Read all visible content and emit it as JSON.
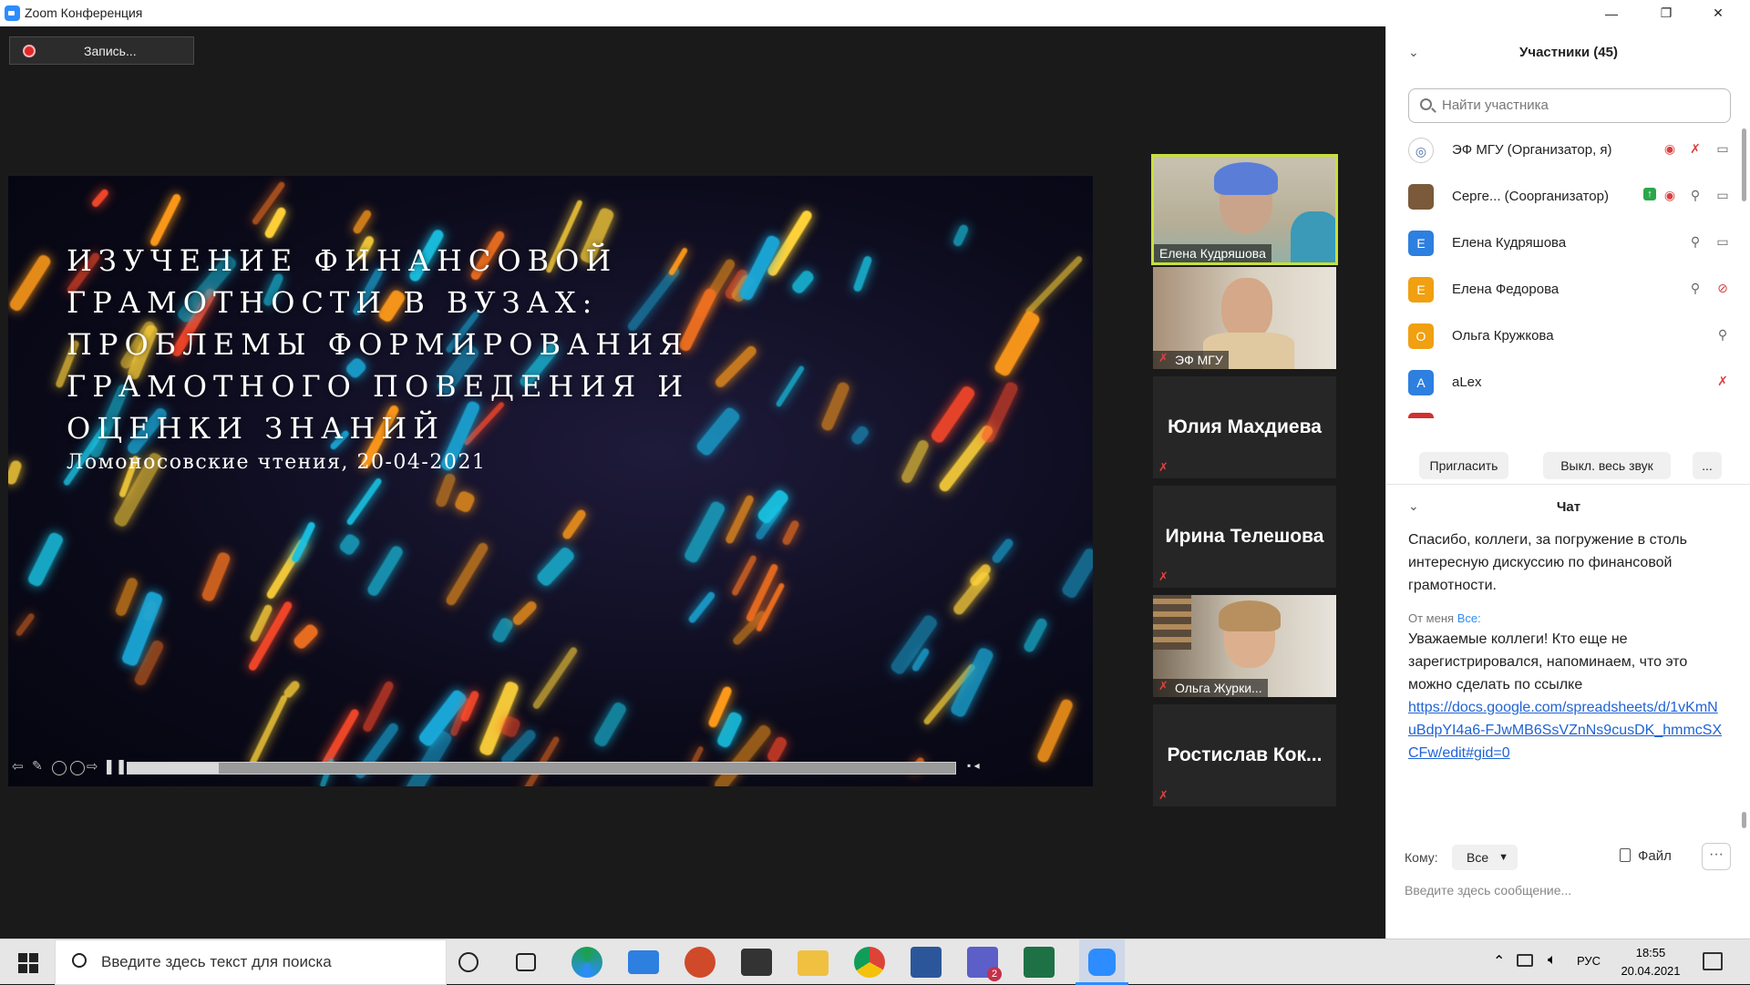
{
  "window": {
    "title": "Zoom Конференция",
    "buttons": {
      "minimize": "—",
      "maximize": "❐",
      "close": "✕"
    }
  },
  "recording": {
    "label": "Запись..."
  },
  "slide": {
    "title": "Изучение финансовой грамотности в вузах: проблемы формирования грамотного поведения и оценки знаний",
    "subtitle": "Ломоносовские чтения, 20-04-2021",
    "progress": 0.11
  },
  "videos": [
    {
      "name": "Елена Кудряшова",
      "type": "video",
      "active": true
    },
    {
      "name": "ЭФ МГУ",
      "type": "video",
      "muted": true
    },
    {
      "name": "Юлия Махдиева",
      "type": "name",
      "muted": true
    },
    {
      "name": "Ирина Телешова",
      "type": "name",
      "muted": true
    },
    {
      "name": "Ольга Журки...",
      "type": "video",
      "muted": true
    },
    {
      "name": "Ростислав Кок...",
      "type": "name",
      "muted": true
    }
  ],
  "panel": {
    "participants_title": "Участники (45)",
    "search_placeholder": "Найти участника",
    "participants": [
      {
        "name": "ЭФ МГУ (Организатор, я)",
        "initial": "",
        "color": "#4a6fa5"
      },
      {
        "name": "Серге...    (Соорганизатор)",
        "initial": "",
        "color": "#7a5a3a"
      },
      {
        "name": "Елена Кудряшова",
        "initial": "Е",
        "color": "#2d7fe0"
      },
      {
        "name": "Елена Федорова",
        "initial": "Е",
        "color": "#f0a010"
      },
      {
        "name": "Ольга Кружкова",
        "initial": "О",
        "color": "#f0a010"
      },
      {
        "name": "aLex",
        "initial": "A",
        "color": "#2d7fe0"
      }
    ],
    "invite": "Пригласить",
    "mute_all": "Выкл. весь звук",
    "more": "...",
    "chat_title": "Чат",
    "chat_msg1": "Спасибо, коллеги, за погружение в столь интересную дискуссию по финансовой грамотности.",
    "chat_from": "От меня",
    "chat_to": "Все:",
    "chat_msg2": "Уважаемые коллеги! Кто еще не зарегистрировался, напоминаем, что это можно сделать по ссылке",
    "chat_link": "https://docs.google.com/spreadsheets/d/1vKmNuBdpYI4a6-FJwMB6SsVZnNs9cusDK_hmmcSXCFw/edit#gid=0",
    "to_label": "Кому:",
    "to_value": "Все",
    "file": "Файл",
    "composer_placeholder": "Введите здесь сообщение..."
  },
  "taskbar": {
    "search_placeholder": "Введите здесь текст для поиска",
    "lang": "РУС",
    "time": "18:55",
    "date": "20.04.2021",
    "teams_badge": "2"
  }
}
